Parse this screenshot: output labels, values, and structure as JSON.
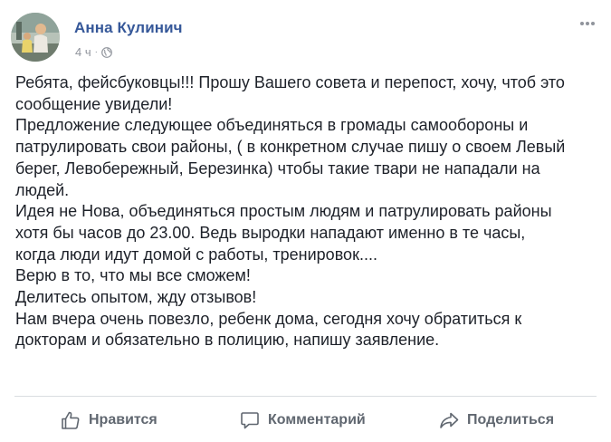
{
  "post": {
    "author": "Анна Кулинич",
    "time": "4 ч",
    "separator": "·",
    "privacy_icon": "globe-icon",
    "body_lines": [
      "Ребята, фейсбуковцы!!! Прошу Вашего совета и перепост, хочу, чтоб это",
      "сообщение увидели!",
      "Предложение следующее объединяться в громады самообороны и",
      "патрулировать свои районы, ( в конкретном случае пишу о своем Левый",
      "берег, Левобережный, Березинка) чтобы такие твари не нападали на",
      "людей.",
      "Идея не Нова, объединяться простым людям и патрулировать районы",
      "хотя бы часов до 23.00. Ведь выродки нападают именно в те часы,",
      "когда люди идут домой с работы, тренировок....",
      "Верю в то, что мы все сможем!",
      "Делитесь опытом, жду отзывов!",
      "Нам вчера очень повезло, ребенк дома, сегодня хочу обратиться к",
      "докторам и обязательно в полицию, напишу заявление."
    ]
  },
  "actions": {
    "like": "Нравится",
    "comment": "Комментарий",
    "share": "Поделиться"
  },
  "colors": {
    "author": "#365899",
    "text": "#1d2129",
    "meta": "#90949c",
    "action": "#606770",
    "divider": "#dadde1"
  }
}
